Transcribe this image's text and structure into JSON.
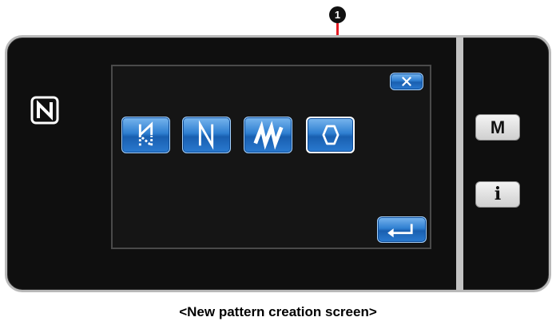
{
  "callout": {
    "number": "1"
  },
  "device": {
    "screen": {
      "close_button": {
        "icon": "close-x-icon"
      },
      "pattern_buttons": [
        {
          "icon": "dashed-zigzag-pattern-icon"
        },
        {
          "icon": "zigzag-pattern-icon"
        },
        {
          "icon": "m-shape-pattern-icon"
        },
        {
          "icon": "polygon-pattern-icon",
          "selected": true
        }
      ],
      "enter_button": {
        "icon": "enter-return-icon"
      }
    },
    "nfc_icon": "nfc-icon",
    "side_keys": {
      "m_label": "M",
      "i_label": "i"
    }
  },
  "caption": "<New pattern creation screen>",
  "colors": {
    "button_blue": "#2f7fd1",
    "callout_red": "#e51b23",
    "bezel": "#0f0f0f"
  }
}
